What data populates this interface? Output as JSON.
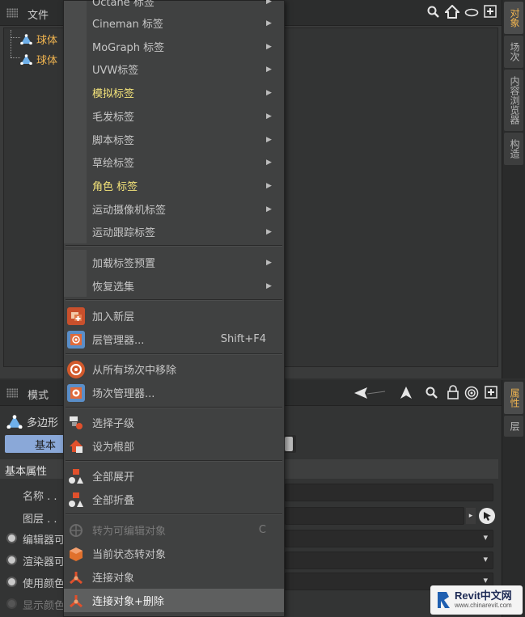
{
  "object_manager": {
    "menu_file": "文件",
    "tree": [
      {
        "label": "球体",
        "icon": "polygon-object-icon"
      },
      {
        "label": "球体",
        "icon": "polygon-object-icon"
      }
    ]
  },
  "right_tabs_top": [
    "对象",
    "场次",
    "内容浏览器",
    "构造"
  ],
  "right_tabs_bottom": [
    "属性",
    "层"
  ],
  "attribute_manager": {
    "menu_mode": "模式",
    "object_label": "多边形",
    "tab_basic": "基本",
    "section_title": "基本属性",
    "fields": [
      {
        "label": "名称 . ."
      },
      {
        "label": "图层 . ."
      }
    ],
    "radio_rows": [
      {
        "label": "编辑器可"
      },
      {
        "label": "渲染器可"
      },
      {
        "label": "使用颜色"
      },
      {
        "label": "显示颜色"
      }
    ]
  },
  "context_menu": {
    "items": [
      {
        "label": "Octane 标签",
        "submenu": true,
        "style": "normal"
      },
      {
        "label": "Cineman 标签",
        "submenu": true,
        "style": "normal"
      },
      {
        "label": "MoGraph 标签",
        "submenu": true,
        "style": "normal"
      },
      {
        "label": "UVW标签",
        "submenu": true,
        "style": "normal"
      },
      {
        "label": "模拟标签",
        "submenu": true,
        "style": "yellow"
      },
      {
        "label": "毛发标签",
        "submenu": true,
        "style": "normal"
      },
      {
        "label": "脚本标签",
        "submenu": true,
        "style": "normal"
      },
      {
        "label": "草绘标签",
        "submenu": true,
        "style": "normal"
      },
      {
        "label": "角色 标签",
        "submenu": true,
        "style": "yellow"
      },
      {
        "label": "运动摄像机标签",
        "submenu": true,
        "style": "normal"
      },
      {
        "label": "运动跟踪标签",
        "submenu": true,
        "style": "normal"
      },
      {
        "label": "加载标签预置",
        "submenu": true,
        "style": "normal"
      },
      {
        "label": "恢复选集",
        "submenu": true,
        "style": "normal"
      },
      {
        "label": "加入新层",
        "icon": "add-layer-icon"
      },
      {
        "label": "层管理器...",
        "shortcut": "Shift+F4",
        "icon": "layer-manager-icon"
      },
      {
        "label": "从所有场次中移除",
        "icon": "remove-from-takes-icon"
      },
      {
        "label": "场次管理器...",
        "icon": "take-manager-icon"
      },
      {
        "label": "选择子级",
        "icon": "select-children-icon"
      },
      {
        "label": "设为根部",
        "icon": "set-as-root-icon"
      },
      {
        "label": "全部展开",
        "icon": "expand-all-icon"
      },
      {
        "label": "全部折叠",
        "icon": "collapse-all-icon"
      },
      {
        "label": "转为可编辑对象",
        "shortcut": "C",
        "icon": "make-editable-icon",
        "disabled": true
      },
      {
        "label": "当前状态转对象",
        "icon": "current-state-to-object-icon"
      },
      {
        "label": "连接对象",
        "icon": "connect-objects-icon"
      },
      {
        "label": "连接对象+删除",
        "icon": "connect-objects-delete-icon",
        "highlighted": true
      }
    ]
  },
  "watermark": {
    "brand": "Revit中文网",
    "url": "www.chinarevit.com"
  },
  "colors": {
    "accent_orange": "#f0b450",
    "menu_yellow": "#f4e47a",
    "tab_blue": "#8aa8d8"
  }
}
